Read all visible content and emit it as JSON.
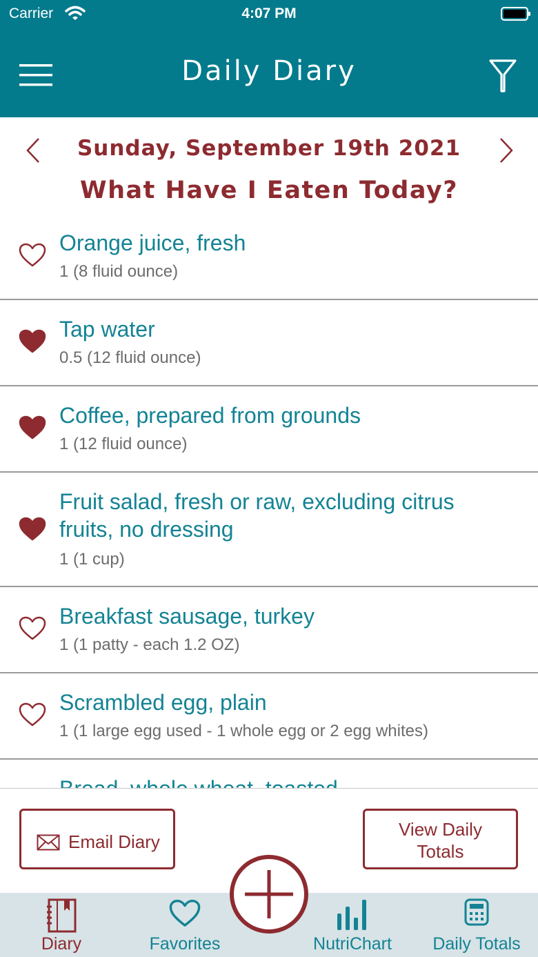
{
  "status_bar": {
    "carrier": "Carrier",
    "time": "4:07 PM"
  },
  "header": {
    "title": "Daily Diary"
  },
  "date_nav": {
    "date": "Sunday, September 19th 2021"
  },
  "heading": "What Have I Eaten Today?",
  "entries": [
    {
      "name": "Orange juice, fresh",
      "portion": "1 (8 fluid ounce)",
      "favorite": false
    },
    {
      "name": "Tap water",
      "portion": "0.5 (12 fluid ounce)",
      "favorite": true
    },
    {
      "name": "Coffee, prepared from grounds",
      "portion": "1 (12 fluid ounce)",
      "favorite": true
    },
    {
      "name": "Fruit salad, fresh or raw,  excluding citrus fruits, no dressing",
      "portion": "1 (1 cup)",
      "favorite": true
    },
    {
      "name": "Breakfast sausage, turkey",
      "portion": "1 (1 patty - each 1.2 OZ)",
      "favorite": false
    },
    {
      "name": "Scrambled egg, plain",
      "portion": "1 (1 large egg used - 1 whole egg or 2 egg whites)",
      "favorite": false
    },
    {
      "name": "Bread, whole wheat, toasted",
      "portion": "",
      "favorite": false
    }
  ],
  "actions": {
    "email": "Email Diary",
    "totals_line1": "View Daily",
    "totals_line2": "Totals"
  },
  "tabs": [
    {
      "label": "Diary",
      "icon": "diary-icon",
      "active": true
    },
    {
      "label": "Favorites",
      "icon": "heart-icon",
      "active": false
    },
    {
      "label": "NutriChart",
      "icon": "bar-chart-icon",
      "active": false
    },
    {
      "label": "Daily Totals",
      "icon": "calculator-icon",
      "active": false
    }
  ],
  "colors": {
    "header": "#037b8c",
    "accent": "#8d2b30",
    "link": "#138394",
    "tab_bar": "#d7e3e6"
  }
}
